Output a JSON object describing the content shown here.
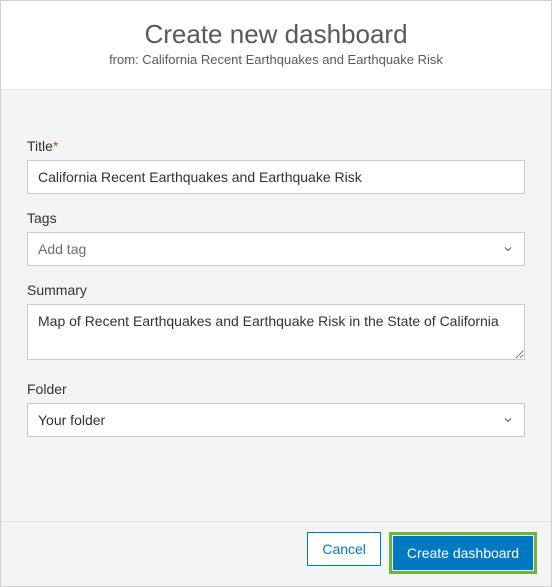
{
  "header": {
    "title": "Create new dashboard",
    "from_prefix": "from: ",
    "from_name": "California Recent Earthquakes and Earthquake Risk"
  },
  "fields": {
    "title": {
      "label": "Title",
      "required_marker": "*",
      "value": "California Recent Earthquakes and Earthquake Risk"
    },
    "tags": {
      "label": "Tags",
      "placeholder": "Add tag"
    },
    "summary": {
      "label": "Summary",
      "value": "Map of Recent Earthquakes and Earthquake Risk in the State of California"
    },
    "folder": {
      "label": "Folder",
      "value": "Your folder"
    }
  },
  "footer": {
    "cancel": "Cancel",
    "create": "Create dashboard"
  }
}
